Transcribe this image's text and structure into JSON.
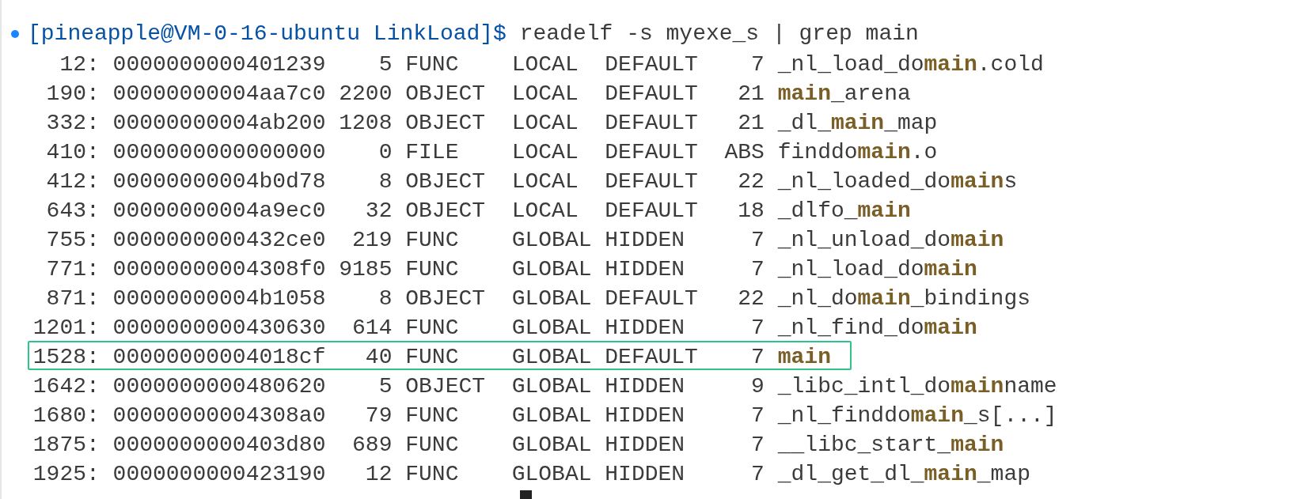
{
  "command": {
    "prompt": "[pineapple@VM-0-16-ubuntu LinkLoad]$",
    "text": "readelf -s myexe_s | grep main"
  },
  "symbols": [
    {
      "num": "12:",
      "value": "0000000000401239",
      "size": "5",
      "type": "FUNC",
      "bind": "LOCAL",
      "vis": "DEFAULT",
      "ndx": "7",
      "name": "_nl_load_do**main**.cold",
      "highlighted": false
    },
    {
      "num": "190:",
      "value": "00000000004aa7c0",
      "size": "2200",
      "type": "OBJECT",
      "bind": "LOCAL",
      "vis": "DEFAULT",
      "ndx": "21",
      "name": "**main**_arena",
      "highlighted": false
    },
    {
      "num": "332:",
      "value": "00000000004ab200",
      "size": "1208",
      "type": "OBJECT",
      "bind": "LOCAL",
      "vis": "DEFAULT",
      "ndx": "21",
      "name": "_dl_**main**_map",
      "highlighted": false
    },
    {
      "num": "410:",
      "value": "0000000000000000",
      "size": "0",
      "type": "FILE",
      "bind": "LOCAL",
      "vis": "DEFAULT",
      "ndx": "ABS",
      "name": "finddo**main**.o",
      "highlighted": false
    },
    {
      "num": "412:",
      "value": "00000000004b0d78",
      "size": "8",
      "type": "OBJECT",
      "bind": "LOCAL",
      "vis": "DEFAULT",
      "ndx": "22",
      "name": "_nl_loaded_do**main**s",
      "highlighted": false
    },
    {
      "num": "643:",
      "value": "00000000004a9ec0",
      "size": "32",
      "type": "OBJECT",
      "bind": "LOCAL",
      "vis": "DEFAULT",
      "ndx": "18",
      "name": "_dlfo_**main**",
      "highlighted": false
    },
    {
      "num": "755:",
      "value": "0000000000432ce0",
      "size": "219",
      "type": "FUNC",
      "bind": "GLOBAL",
      "vis": "HIDDEN",
      "ndx": "7",
      "name": "_nl_unload_do**main**",
      "highlighted": false
    },
    {
      "num": "771:",
      "value": "00000000004308f0",
      "size": "9185",
      "type": "FUNC",
      "bind": "GLOBAL",
      "vis": "HIDDEN",
      "ndx": "7",
      "name": "_nl_load_do**main**",
      "highlighted": false
    },
    {
      "num": "871:",
      "value": "00000000004b1058",
      "size": "8",
      "type": "OBJECT",
      "bind": "GLOBAL",
      "vis": "DEFAULT",
      "ndx": "22",
      "name": "_nl_do**main**_bindings",
      "highlighted": false
    },
    {
      "num": "1201:",
      "value": "0000000000430630",
      "size": "614",
      "type": "FUNC",
      "bind": "GLOBAL",
      "vis": "HIDDEN",
      "ndx": "7",
      "name": "_nl_find_do**main**",
      "highlighted": false
    },
    {
      "num": "1528:",
      "value": "00000000004018cf",
      "size": "40",
      "type": "FUNC",
      "bind": "GLOBAL",
      "vis": "DEFAULT",
      "ndx": "7",
      "name": "**main**",
      "highlighted": true
    },
    {
      "num": "1642:",
      "value": "0000000000480620",
      "size": "5",
      "type": "OBJECT",
      "bind": "GLOBAL",
      "vis": "HIDDEN",
      "ndx": "9",
      "name": "_libc_intl_do**main**name",
      "highlighted": false
    },
    {
      "num": "1680:",
      "value": "00000000004308a0",
      "size": "79",
      "type": "FUNC",
      "bind": "GLOBAL",
      "vis": "HIDDEN",
      "ndx": "7",
      "name": "_nl_finddo**main**_s[...]",
      "highlighted": false
    },
    {
      "num": "1875:",
      "value": "0000000000403d80",
      "size": "689",
      "type": "FUNC",
      "bind": "GLOBAL",
      "vis": "HIDDEN",
      "ndx": "7",
      "name": "__libc_start_**main**",
      "highlighted": false
    },
    {
      "num": "1925:",
      "value": "0000000000423190",
      "size": "12",
      "type": "FUNC",
      "bind": "GLOBAL",
      "vis": "HIDDEN",
      "ndx": "7",
      "name": "_dl_get_dl_**main**_map",
      "highlighted": false
    }
  ],
  "next_prompt": {
    "cursor": true
  }
}
